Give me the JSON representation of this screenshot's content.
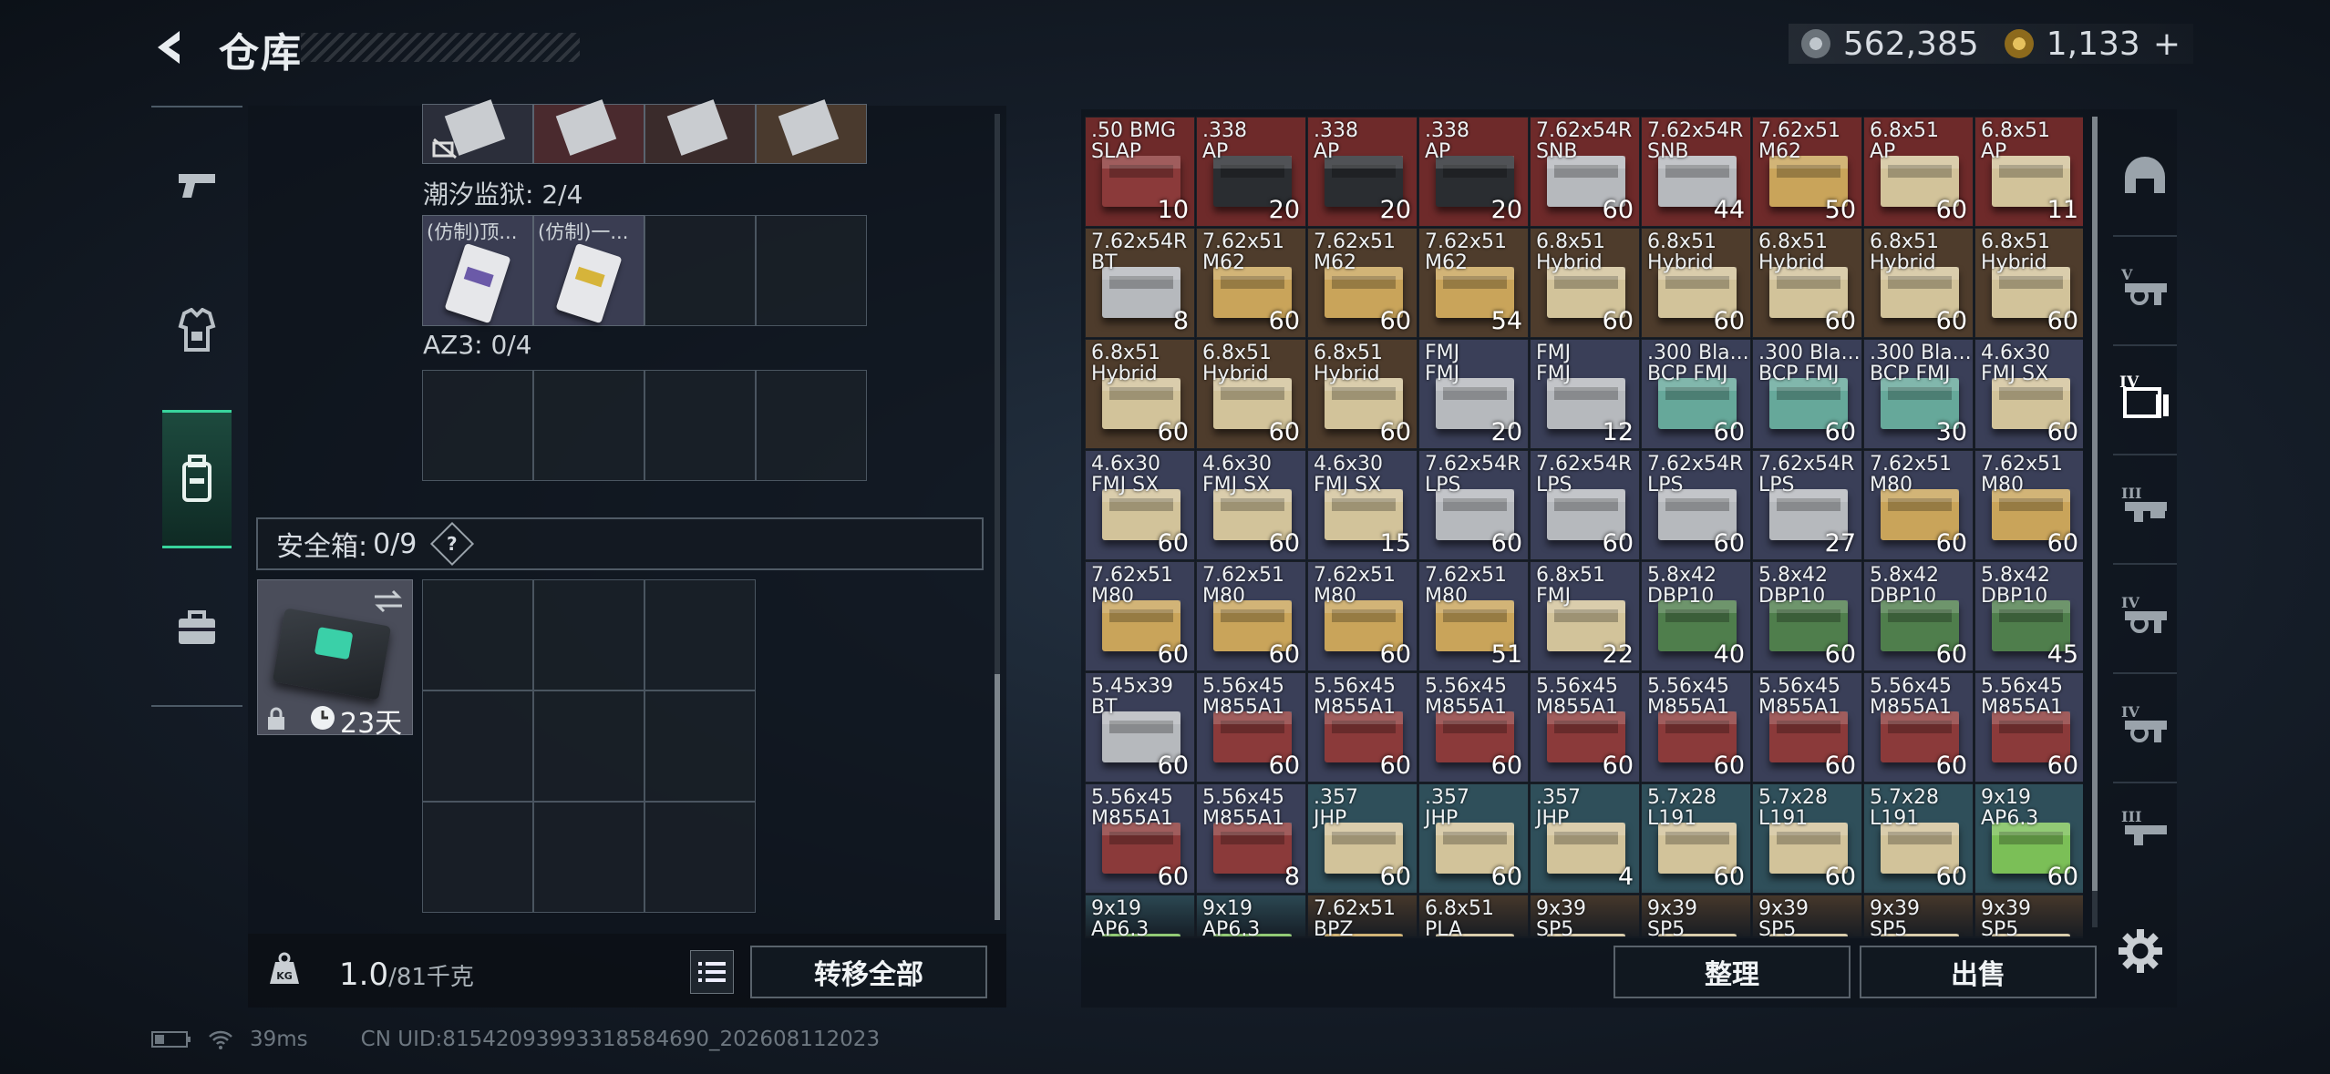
{
  "header": {
    "title": "仓库"
  },
  "currency": {
    "silver": "562,385",
    "gold": "1,133",
    "plus": "+"
  },
  "left_rail": {
    "items": [
      "pistol-icon",
      "armor-icon",
      "backpack-icon",
      "briefcase-icon"
    ],
    "active_index": 2
  },
  "containers": {
    "tidal_label": "潮汐监狱: 2/4",
    "tidal_items": [
      "(仿制)顶...",
      "(仿制)一..."
    ],
    "az3_label": "AZ3: 0/4"
  },
  "safe_box": {
    "label": "安全箱:",
    "count": "0/9",
    "help": "?",
    "days": "23天"
  },
  "bottom_left": {
    "weight_value": "1.0",
    "weight_unit": "/81千克",
    "transfer_all": "转移全部"
  },
  "bottom_right": {
    "organize": "整理",
    "sell": "出售"
  },
  "status_bar": {
    "ping": "39ms",
    "uid": "CN UID:81542093993318584690_202608112023"
  },
  "right_rail": {
    "items": [
      "helmet-icon",
      "rifle-v-icon",
      "rifle-iv-icon",
      "rifle-iii-icon",
      "rifle-iv-icon",
      "rifle-iv-icon",
      "rifle-iii-icon"
    ]
  },
  "ammo_colors": {
    "red": "#6e2a2a",
    "brown": "#4e3c2c",
    "slate": "#3a3f58",
    "teal": "#2f4f5a",
    "crate_black": "#2a2d31",
    "crate_silver": "#b6b9bd",
    "crate_tan": "#c9a45a",
    "crate_green": "#4f7e4c",
    "crate_mint": "#66a89a",
    "crate_lime": "#7bbf57",
    "crate_cream": "#d2c39a",
    "crate_red": "#8b3a3a"
  },
  "ammo_grid": [
    {
      "name": ".50 BMG\nSLAP",
      "count": "10",
      "bg": "red",
      "crate": "crate_red"
    },
    {
      "name": ".338\nAP",
      "count": "20",
      "bg": "red",
      "crate": "crate_black"
    },
    {
      "name": ".338\nAP",
      "count": "20",
      "bg": "red",
      "crate": "crate_black"
    },
    {
      "name": ".338\nAP",
      "count": "20",
      "bg": "red",
      "crate": "crate_black"
    },
    {
      "name": "7.62x54R\nSNB",
      "count": "60",
      "bg": "red",
      "crate": "crate_silver"
    },
    {
      "name": "7.62x54R\nSNB",
      "count": "44",
      "bg": "red",
      "crate": "crate_silver"
    },
    {
      "name": "7.62x51\nM62",
      "count": "50",
      "bg": "red",
      "crate": "crate_tan"
    },
    {
      "name": "6.8x51\nAP",
      "count": "60",
      "bg": "red",
      "crate": "crate_cream"
    },
    {
      "name": "6.8x51\nAP",
      "count": "11",
      "bg": "red",
      "crate": "crate_cream"
    },
    {
      "name": "7.62x54R\nBT",
      "count": "8",
      "bg": "brown",
      "crate": "crate_silver"
    },
    {
      "name": "7.62x51\nM62",
      "count": "60",
      "bg": "brown",
      "crate": "crate_tan"
    },
    {
      "name": "7.62x51\nM62",
      "count": "60",
      "bg": "brown",
      "crate": "crate_tan"
    },
    {
      "name": "7.62x51\nM62",
      "count": "54",
      "bg": "brown",
      "crate": "crate_tan"
    },
    {
      "name": "6.8x51\nHybrid",
      "count": "60",
      "bg": "brown",
      "crate": "crate_cream"
    },
    {
      "name": "6.8x51\nHybrid",
      "count": "60",
      "bg": "brown",
      "crate": "crate_cream"
    },
    {
      "name": "6.8x51\nHybrid",
      "count": "60",
      "bg": "brown",
      "crate": "crate_cream"
    },
    {
      "name": "6.8x51\nHybrid",
      "count": "60",
      "bg": "brown",
      "crate": "crate_cream"
    },
    {
      "name": "6.8x51\nHybrid",
      "count": "60",
      "bg": "brown",
      "crate": "crate_cream"
    },
    {
      "name": "6.8x51\nHybrid",
      "count": "60",
      "bg": "brown",
      "crate": "crate_cream"
    },
    {
      "name": "6.8x51\nHybrid",
      "count": "60",
      "bg": "brown",
      "crate": "crate_cream"
    },
    {
      "name": "6.8x51\nHybrid",
      "count": "60",
      "bg": "brown",
      "crate": "crate_cream"
    },
    {
      "name": "FMJ\nFMJ",
      "count": "20",
      "bg": "slate",
      "crate": "crate_silver"
    },
    {
      "name": "FMJ\nFMJ",
      "count": "12",
      "bg": "slate",
      "crate": "crate_silver"
    },
    {
      "name": ".300 Bla...\nBCP FMJ",
      "count": "60",
      "bg": "slate",
      "crate": "crate_mint"
    },
    {
      "name": ".300 Bla...\nBCP FMJ",
      "count": "60",
      "bg": "slate",
      "crate": "crate_mint"
    },
    {
      "name": ".300 Bla...\nBCP FMJ",
      "count": "30",
      "bg": "slate",
      "crate": "crate_mint"
    },
    {
      "name": "4.6x30\nFMJ SX",
      "count": "60",
      "bg": "slate",
      "crate": "crate_cream"
    },
    {
      "name": "4.6x30\nFMJ SX",
      "count": "60",
      "bg": "slate",
      "crate": "crate_cream"
    },
    {
      "name": "4.6x30\nFMJ SX",
      "count": "60",
      "bg": "slate",
      "crate": "crate_cream"
    },
    {
      "name": "4.6x30\nFMJ SX",
      "count": "15",
      "bg": "slate",
      "crate": "crate_cream"
    },
    {
      "name": "7.62x54R\nLPS",
      "count": "60",
      "bg": "slate",
      "crate": "crate_silver"
    },
    {
      "name": "7.62x54R\nLPS",
      "count": "60",
      "bg": "slate",
      "crate": "crate_silver"
    },
    {
      "name": "7.62x54R\nLPS",
      "count": "60",
      "bg": "slate",
      "crate": "crate_silver"
    },
    {
      "name": "7.62x54R\nLPS",
      "count": "27",
      "bg": "slate",
      "crate": "crate_silver"
    },
    {
      "name": "7.62x51\nM80",
      "count": "60",
      "bg": "slate",
      "crate": "crate_tan"
    },
    {
      "name": "7.62x51\nM80",
      "count": "60",
      "bg": "slate",
      "crate": "crate_tan"
    },
    {
      "name": "7.62x51\nM80",
      "count": "60",
      "bg": "slate",
      "crate": "crate_tan"
    },
    {
      "name": "7.62x51\nM80",
      "count": "60",
      "bg": "slate",
      "crate": "crate_tan"
    },
    {
      "name": "7.62x51\nM80",
      "count": "60",
      "bg": "slate",
      "crate": "crate_tan"
    },
    {
      "name": "7.62x51\nM80",
      "count": "51",
      "bg": "slate",
      "crate": "crate_tan"
    },
    {
      "name": "6.8x51\nFMJ",
      "count": "22",
      "bg": "slate",
      "crate": "crate_cream"
    },
    {
      "name": "5.8x42\nDBP10",
      "count": "40",
      "bg": "slate",
      "crate": "crate_green"
    },
    {
      "name": "5.8x42\nDBP10",
      "count": "60",
      "bg": "slate",
      "crate": "crate_green"
    },
    {
      "name": "5.8x42\nDBP10",
      "count": "60",
      "bg": "slate",
      "crate": "crate_green"
    },
    {
      "name": "5.8x42\nDBP10",
      "count": "45",
      "bg": "slate",
      "crate": "crate_green"
    },
    {
      "name": "5.45x39\nBT",
      "count": "60",
      "bg": "slate",
      "crate": "crate_silver"
    },
    {
      "name": "5.56x45\nM855A1",
      "count": "60",
      "bg": "slate",
      "crate": "crate_red"
    },
    {
      "name": "5.56x45\nM855A1",
      "count": "60",
      "bg": "slate",
      "crate": "crate_red"
    },
    {
      "name": "5.56x45\nM855A1",
      "count": "60",
      "bg": "slate",
      "crate": "crate_red"
    },
    {
      "name": "5.56x45\nM855A1",
      "count": "60",
      "bg": "slate",
      "crate": "crate_red"
    },
    {
      "name": "5.56x45\nM855A1",
      "count": "60",
      "bg": "slate",
      "crate": "crate_red"
    },
    {
      "name": "5.56x45\nM855A1",
      "count": "60",
      "bg": "slate",
      "crate": "crate_red"
    },
    {
      "name": "5.56x45\nM855A1",
      "count": "60",
      "bg": "slate",
      "crate": "crate_red"
    },
    {
      "name": "5.56x45\nM855A1",
      "count": "60",
      "bg": "slate",
      "crate": "crate_red"
    },
    {
      "name": "5.56x45\nM855A1",
      "count": "60",
      "bg": "slate",
      "crate": "crate_red"
    },
    {
      "name": "5.56x45\nM855A1",
      "count": "8",
      "bg": "slate",
      "crate": "crate_red"
    },
    {
      "name": ".357\nJHP",
      "count": "60",
      "bg": "teal",
      "crate": "crate_cream"
    },
    {
      "name": ".357\nJHP",
      "count": "60",
      "bg": "teal",
      "crate": "crate_cream"
    },
    {
      "name": ".357\nJHP",
      "count": "4",
      "bg": "teal",
      "crate": "crate_cream"
    },
    {
      "name": "5.7x28\nL191",
      "count": "60",
      "bg": "teal",
      "crate": "crate_cream"
    },
    {
      "name": "5.7x28\nL191",
      "count": "60",
      "bg": "teal",
      "crate": "crate_cream"
    },
    {
      "name": "5.7x28\nL191",
      "count": "60",
      "bg": "teal",
      "crate": "crate_cream"
    },
    {
      "name": "9x19\nAP6.3",
      "count": "60",
      "bg": "teal",
      "crate": "crate_lime"
    },
    {
      "name": "9x19\nAP6.3",
      "count": "",
      "bg": "teal",
      "crate": "crate_lime"
    },
    {
      "name": "9x19\nAP6.3",
      "count": "",
      "bg": "teal",
      "crate": "crate_lime"
    },
    {
      "name": "7.62x51\nBPZ",
      "count": "",
      "bg": "brown",
      "crate": "crate_tan"
    },
    {
      "name": "6.8x51\nPLA",
      "count": "",
      "bg": "brown",
      "crate": "crate_cream"
    },
    {
      "name": "9x39\nSP5",
      "count": "",
      "bg": "brown",
      "crate": "crate_cream"
    },
    {
      "name": "9x39\nSP5",
      "count": "",
      "bg": "brown",
      "crate": "crate_cream"
    },
    {
      "name": "9x39\nSP5",
      "count": "",
      "bg": "brown",
      "crate": "crate_cream"
    },
    {
      "name": "9x39\nSP5",
      "count": "",
      "bg": "brown",
      "crate": "crate_cream"
    },
    {
      "name": "9x39\nSP5",
      "count": "",
      "bg": "brown",
      "crate": "crate_cream"
    }
  ]
}
